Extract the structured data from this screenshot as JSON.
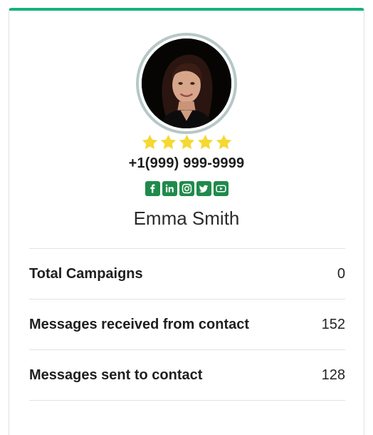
{
  "profile": {
    "name": "Emma Smith",
    "phone": "+1(999) 999-9999",
    "rating": 5,
    "rating_max": 5,
    "star_color": "#f5d832",
    "social_color": "#1f8a4c",
    "accent_color": "#18b27a",
    "socials": [
      {
        "icon": "facebook-icon"
      },
      {
        "icon": "linkedin-icon"
      },
      {
        "icon": "instagram-icon"
      },
      {
        "icon": "twitter-icon"
      },
      {
        "icon": "youtube-icon"
      }
    ]
  },
  "stats": [
    {
      "label": "Total Campaigns",
      "value": "0"
    },
    {
      "label": "Messages received from contact",
      "value": "152"
    },
    {
      "label": "Messages sent to contact",
      "value": "128"
    }
  ]
}
